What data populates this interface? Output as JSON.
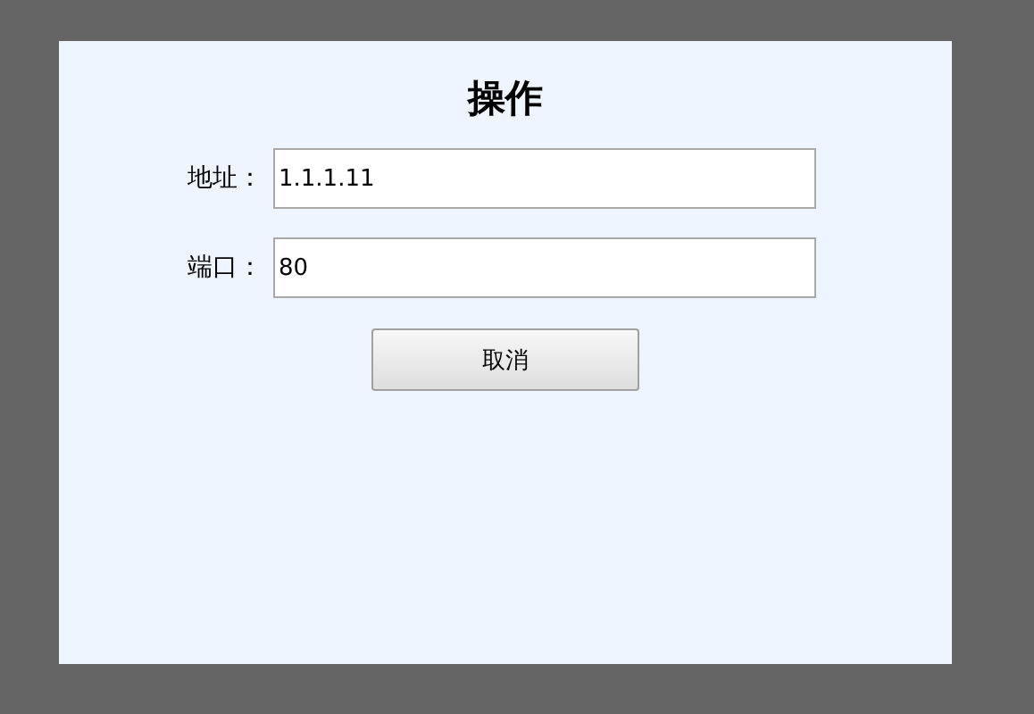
{
  "dialog": {
    "title": "操作",
    "fields": [
      {
        "label": "地址：",
        "value": "1.1.1.11"
      },
      {
        "label": "端口：",
        "value": "80"
      }
    ],
    "buttons": [
      "取消"
    ]
  }
}
